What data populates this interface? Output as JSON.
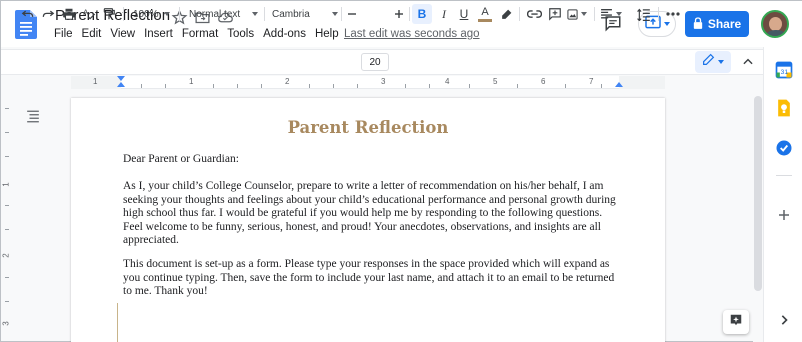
{
  "header": {
    "doc_title": "Parent Reflection",
    "menu": [
      "File",
      "Edit",
      "View",
      "Insert",
      "Format",
      "Tools",
      "Add-ons",
      "Help"
    ],
    "last_edit": "Last edit was seconds ago",
    "share_label": "Share"
  },
  "toolbar": {
    "zoom": "100%",
    "style": "Normal text",
    "font": "Cambria",
    "font_size": "20",
    "bold": "B",
    "italic": "I",
    "underline": "U",
    "text_color_letter": "A"
  },
  "ruler": {
    "numbers": [
      "1",
      "1",
      "2",
      "3",
      "4",
      "5",
      "6",
      "7"
    ],
    "vertical_numbers": [
      "1",
      "2",
      "3"
    ]
  },
  "document": {
    "title": "Parent Reflection",
    "greeting": "Dear Parent or Guardian:",
    "paragraph1": "As I, your child’s College Counselor, prepare to write a letter of recommendation on his/her behalf, I am seeking your thoughts and feelings about your child’s educational performance and personal growth during high school thus far. I would be grateful if you would help me by responding to the following questions. Feel welcome to be funny, serious, honest, and proud! Your anecdotes, observations, and insights are all appreciated.",
    "paragraph2": "This document is set-up as a form. Please type your responses in the space provided which will expand as you continue typing. Then, save the form to include your last name, and attach it to an email to be returned to me. Thank you!"
  },
  "colors": {
    "title_color": "#a8895f",
    "share_blue": "#1a73e8",
    "bold_active_bg": "#e8f0fe"
  },
  "icons": {
    "header": [
      "docs-logo-icon",
      "star-icon",
      "move-folder-icon",
      "cloud-saved-icon",
      "comment-history-icon",
      "present-icon",
      "lock-icon",
      "avatar"
    ],
    "toolbar": [
      "undo-icon",
      "redo-icon",
      "print-icon",
      "spellcheck-icon",
      "paint-format-icon",
      "link-icon",
      "insert-comment-icon",
      "insert-image-icon",
      "align-icon",
      "line-spacing-icon",
      "more-icon",
      "editing-pencil-icon"
    ],
    "side_panel": [
      "calendar-icon",
      "keep-icon",
      "tasks-icon",
      "add-icon",
      "expand-icon"
    ]
  }
}
